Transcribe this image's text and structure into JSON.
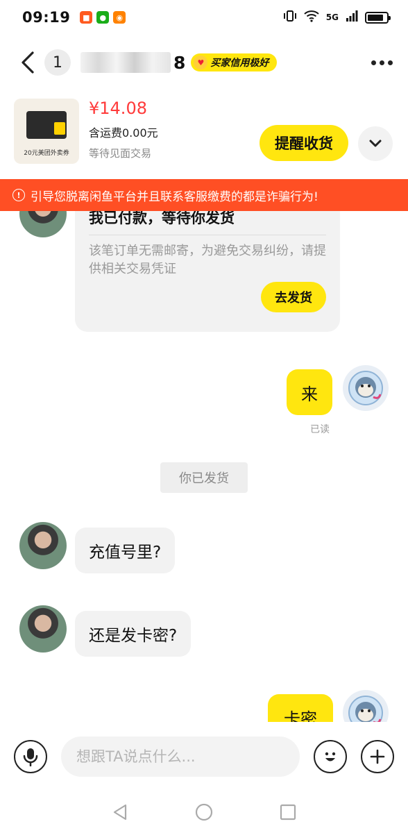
{
  "status_bar": {
    "time": "09:19",
    "network": "5G",
    "apps": [
      {
        "icon": "taobao-icon",
        "color": "#ff5a1f",
        "glyph": "淘"
      },
      {
        "icon": "wechat-icon",
        "color": "#1aad19",
        "glyph": "微"
      },
      {
        "icon": "weibo-icon",
        "color": "#ff8200",
        "glyph": "微"
      }
    ],
    "battery_level": 0.85
  },
  "header": {
    "unread_count": "1",
    "nickname_prefix": "",
    "nickname_suffix": "8",
    "credit_badge": "买家信用极好"
  },
  "product": {
    "price": "¥14.08",
    "shipping": "含运费0.00元",
    "trade_mode": "等待见面交易",
    "thumb_caption": "20元美团外卖券",
    "remind_button": "提醒收货"
  },
  "warning": {
    "text": "引导您脱离闲鱼平台并且联系客服缴费的都是诈骗行为!"
  },
  "chat": {
    "order_card": {
      "title": "我已付款，等待你发货",
      "description": "该笔订单无需邮寄，为避免交易纠纷，请提供相关交易凭证",
      "button": "去发货"
    },
    "messages": [
      {
        "from": "me",
        "text": "来",
        "status": "已读"
      },
      {
        "from": "system",
        "text": "你已发货"
      },
      {
        "from": "them",
        "text": "充值号里?"
      },
      {
        "from": "them",
        "text": "还是发卡密?"
      },
      {
        "from": "me",
        "text": "卡密"
      }
    ]
  },
  "input": {
    "placeholder": "想跟TA说点什么..."
  },
  "colors": {
    "accent": "#ffe60f",
    "warning": "#ff4f24",
    "price": "#ff3a3a"
  }
}
